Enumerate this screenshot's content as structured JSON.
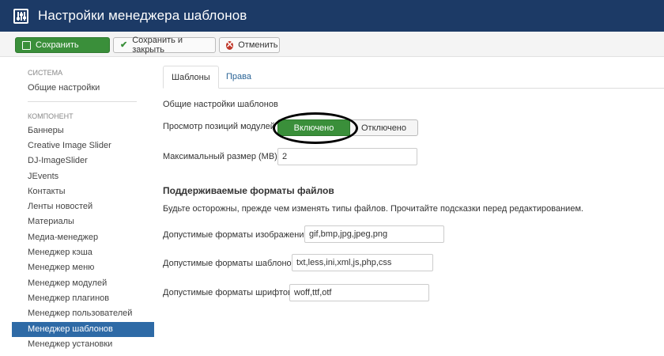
{
  "header": {
    "title": "Настройки менеджера шаблонов",
    "logo_icon": "joomla-settings-icon",
    "background": "#1c3a66"
  },
  "toolbar": {
    "save_label": "Сохранить",
    "save_close_label": "Сохранить и закрыть",
    "cancel_label": "Отменить"
  },
  "sidebar": {
    "system_heading": "СИСТЕМА",
    "general_settings": "Общие настройки",
    "component_heading": "КОМПОНЕНТ",
    "items": [
      "Баннеры",
      "Creative Image Slider",
      "DJ-ImageSlider",
      "JEvents",
      "Контакты",
      "Ленты новостей",
      "Материалы",
      "Медиа-менеджер",
      "Менеджер кэша",
      "Менеджер меню",
      "Менеджер модулей",
      "Менеджер плагинов",
      "Менеджер пользователей",
      "Менеджер шаблонов",
      "Менеджер установки"
    ],
    "active_item": "Менеджер шаблонов"
  },
  "tabs": [
    {
      "label": "Шаблоны",
      "active": true
    },
    {
      "label": "Права",
      "active": false
    }
  ],
  "form": {
    "general_heading": "Общие настройки шаблонов",
    "preview_label": "Просмотр позиций модулей",
    "toggle_on": "Включено",
    "toggle_off": "Отключено",
    "toggle_value": "Включено",
    "max_size_label": "Максимальный размер (MB)",
    "max_size_value": "2",
    "formats_heading": "Поддерживаемые форматы файлов",
    "warning_text": "Будьте осторожны, прежде чем изменять типы файлов. Прочитайте подсказки перед редактированием.",
    "image_formats_label": "Допустимые форматы изображений",
    "image_formats_value": "gif,bmp,jpg,jpeg,png",
    "template_formats_label": "Допустимые форматы шаблонов",
    "template_formats_value": "txt,less,ini,xml,js,php,css",
    "font_formats_label": "Допустимые форматы шрифтов",
    "font_formats_value": "woff,ttf,otf"
  },
  "colors": {
    "accent_green": "#3a8f3a",
    "sidebar_active": "#2e6aa6",
    "link": "#2a6496"
  }
}
